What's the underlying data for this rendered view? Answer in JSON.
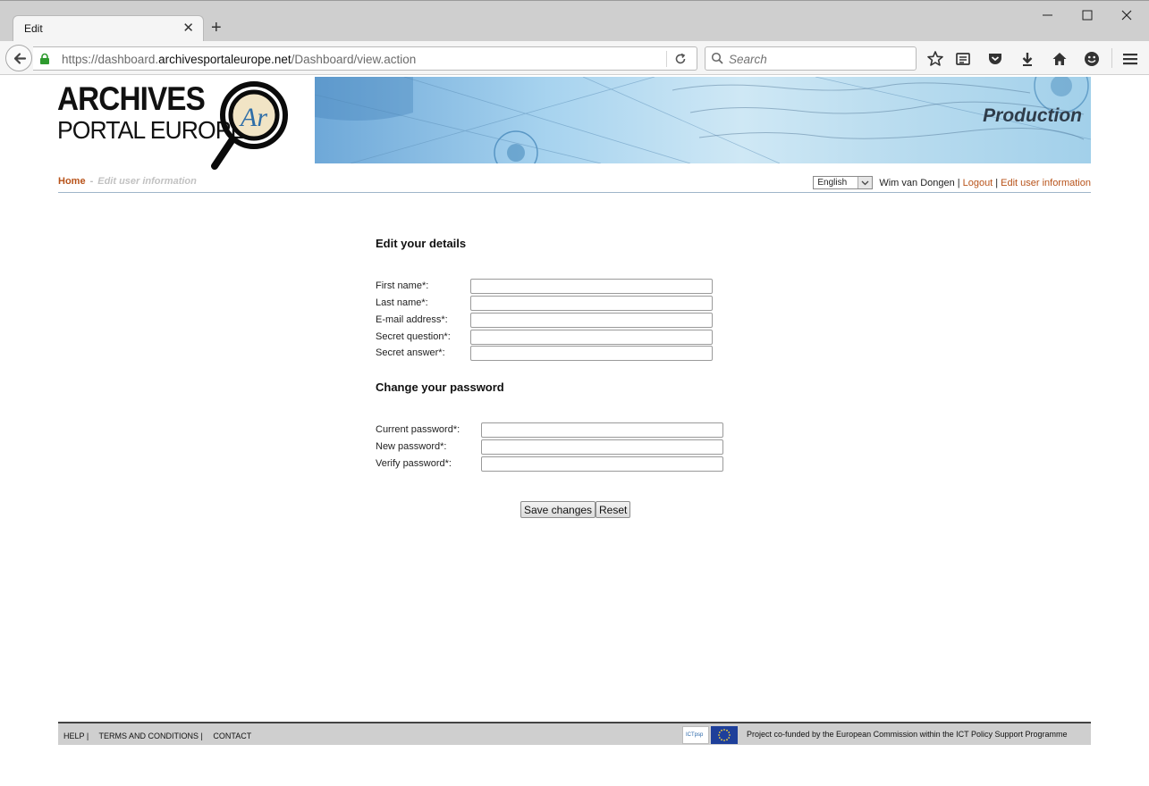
{
  "browser": {
    "tab_title": "Edit",
    "url_prefix": "https://dashboard.",
    "url_host": "archivesportaleurope.net",
    "url_path": "/Dashboard/view.action",
    "search_placeholder": "Search"
  },
  "header": {
    "logo_line1": "ARCHIVES",
    "logo_line2": "PORTAL EUROPE",
    "logo_mark": "Ar",
    "banner_title": "Production"
  },
  "breadcrumb": {
    "home": "Home",
    "separator": "-",
    "current": "Edit user information"
  },
  "userbar": {
    "language": "English",
    "user_name": "Wim van Dongen",
    "separator": "|",
    "logout": "Logout",
    "edit_user": "Edit user information"
  },
  "details": {
    "title": "Edit your details",
    "first_name": "First name*:",
    "last_name": "Last name*:",
    "email": "E-mail address*:",
    "secret_question": "Secret question*:",
    "secret_answer": "Secret answer*:"
  },
  "password": {
    "title": "Change your password",
    "current": "Current password*:",
    "new": "New password*:",
    "verify": "Verify password*:"
  },
  "actions": {
    "save": "Save changes",
    "reset": "Reset"
  },
  "footer": {
    "help": "HELP |",
    "terms": "TERMS AND CONDITIONS |",
    "contact": "CONTACT",
    "ict_label": "ICTpsp",
    "note": "Project co-funded by the European Commission within the ICT Policy Support Programme"
  }
}
